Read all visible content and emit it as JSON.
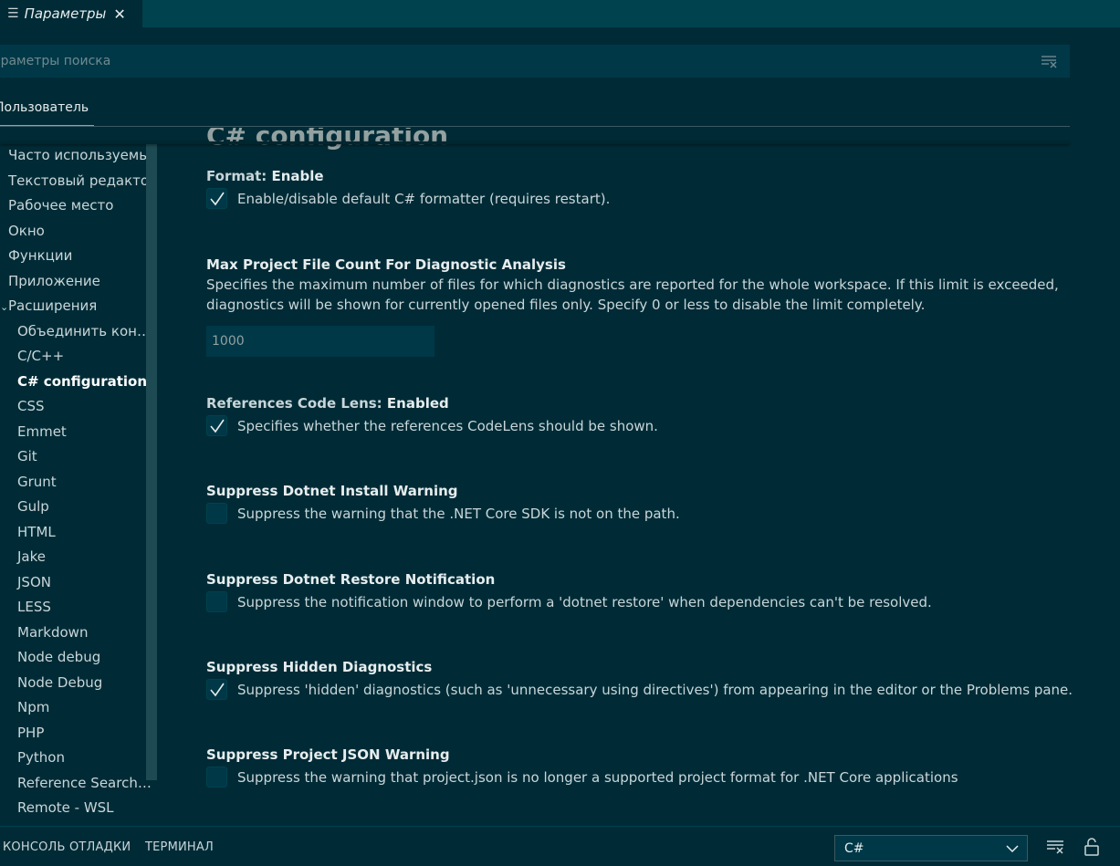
{
  "tab": {
    "title": "Параметры",
    "icon": "preview-lines-icon",
    "close_glyph": "✕"
  },
  "search": {
    "placeholder": "араметры поиска",
    "value": ""
  },
  "scope": {
    "user_tab": "Пользователь"
  },
  "toc": {
    "items": [
      {
        "label": "Часто используемые",
        "level": 0
      },
      {
        "label": "Текстовый редактор",
        "level": 0
      },
      {
        "label": "Рабочее место",
        "level": 0
      },
      {
        "label": "Окно",
        "level": 0
      },
      {
        "label": "Функции",
        "level": 0
      },
      {
        "label": "Приложение",
        "level": 0
      },
      {
        "label": "Расширения",
        "level": 0,
        "expanded": true
      },
      {
        "label": "Объединить конф...",
        "level": 1
      },
      {
        "label": "C/C++",
        "level": 1
      },
      {
        "label": "C# configuration",
        "level": 1,
        "active": true
      },
      {
        "label": "CSS",
        "level": 1
      },
      {
        "label": "Emmet",
        "level": 1
      },
      {
        "label": "Git",
        "level": 1
      },
      {
        "label": "Grunt",
        "level": 1
      },
      {
        "label": "Gulp",
        "level": 1
      },
      {
        "label": "HTML",
        "level": 1
      },
      {
        "label": "Jake",
        "level": 1
      },
      {
        "label": "JSON",
        "level": 1
      },
      {
        "label": "LESS",
        "level": 1
      },
      {
        "label": "Markdown",
        "level": 1
      },
      {
        "label": "Node debug",
        "level": 1
      },
      {
        "label": "Node Debug",
        "level": 1
      },
      {
        "label": "Npm",
        "level": 1
      },
      {
        "label": "PHP",
        "level": 1
      },
      {
        "label": "Python",
        "level": 1
      },
      {
        "label": "Reference Search V...",
        "level": 1
      },
      {
        "label": "Remote - WSL",
        "level": 1
      }
    ]
  },
  "main": {
    "section_title": "C# configuration",
    "settings": [
      {
        "category": "Format: ",
        "name": "Enable",
        "description": "",
        "checkbox": true,
        "checked": true,
        "check_label": "Enable/disable default C# formatter (requires restart)."
      },
      {
        "category": "",
        "name": "Max Project File Count For Diagnostic Analysis",
        "description": "Specifies the maximum number of files for which diagnostics are reported for the whole workspace. If this limit is exceeded, diagnostics will be shown for currently opened files only. Specify 0 or less to disable the limit completely.",
        "checkbox": false,
        "input_value": "1000"
      },
      {
        "category": "References Code Lens: ",
        "name": "Enabled",
        "description": "",
        "checkbox": true,
        "checked": true,
        "check_label": "Specifies whether the references CodeLens should be shown."
      },
      {
        "category": "",
        "name": "Suppress Dotnet Install Warning",
        "description": "",
        "checkbox": true,
        "checked": false,
        "check_label": "Suppress the warning that the .NET Core SDK is not on the path."
      },
      {
        "category": "",
        "name": "Suppress Dotnet Restore Notification",
        "description": "",
        "checkbox": true,
        "checked": false,
        "check_label": "Suppress the notification window to perform a 'dotnet restore' when dependencies can't be resolved."
      },
      {
        "category": "",
        "name": "Suppress Hidden Diagnostics",
        "description": "",
        "checkbox": true,
        "checked": true,
        "check_label": "Suppress 'hidden' diagnostics (such as 'unnecessary using directives') from appearing in the editor or the Problems pane."
      },
      {
        "category": "",
        "name": "Suppress Project JSON Warning",
        "description": "",
        "checkbox": true,
        "checked": false,
        "check_label": "Suppress the warning that project.json is no longer a supported project format for .NET Core applications"
      }
    ]
  },
  "panel": {
    "tabs": [
      "КОНСОЛЬ ОТЛАДКИ",
      "ТЕРМИНАЛ"
    ],
    "language": "C#",
    "icons": [
      "clear-output-icon",
      "lock-icon"
    ]
  },
  "colors": {
    "background": "#002b36",
    "tabbar": "#00424d",
    "input": "#003847",
    "accent_text": "#e6edee"
  }
}
